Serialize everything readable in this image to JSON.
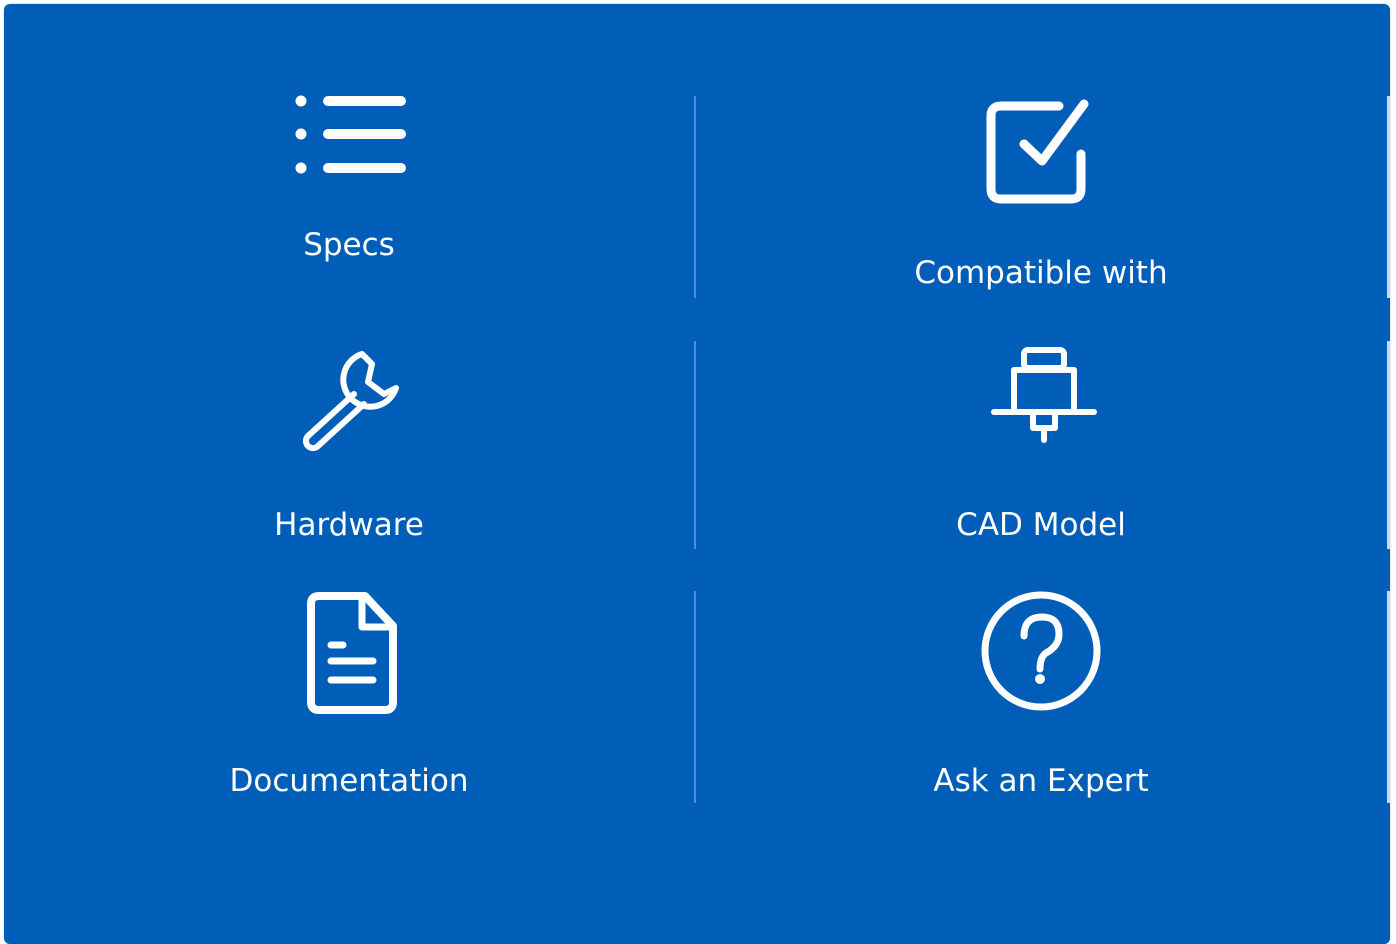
{
  "colors": {
    "panel_background": "#005eb8",
    "icon_and_text": "#ffffff",
    "divider": "#4d8fd0"
  },
  "tiles": [
    {
      "label": "Specs",
      "icon": "list-icon"
    },
    {
      "label": "Compatible with",
      "icon": "checkbox-check-icon"
    },
    {
      "label": "Hardware",
      "icon": "wrench-icon"
    },
    {
      "label": "CAD Model",
      "icon": "cad-model-icon"
    },
    {
      "label": "Documentation",
      "icon": "document-icon"
    },
    {
      "label": "Ask an Expert",
      "icon": "question-circle-icon"
    }
  ]
}
